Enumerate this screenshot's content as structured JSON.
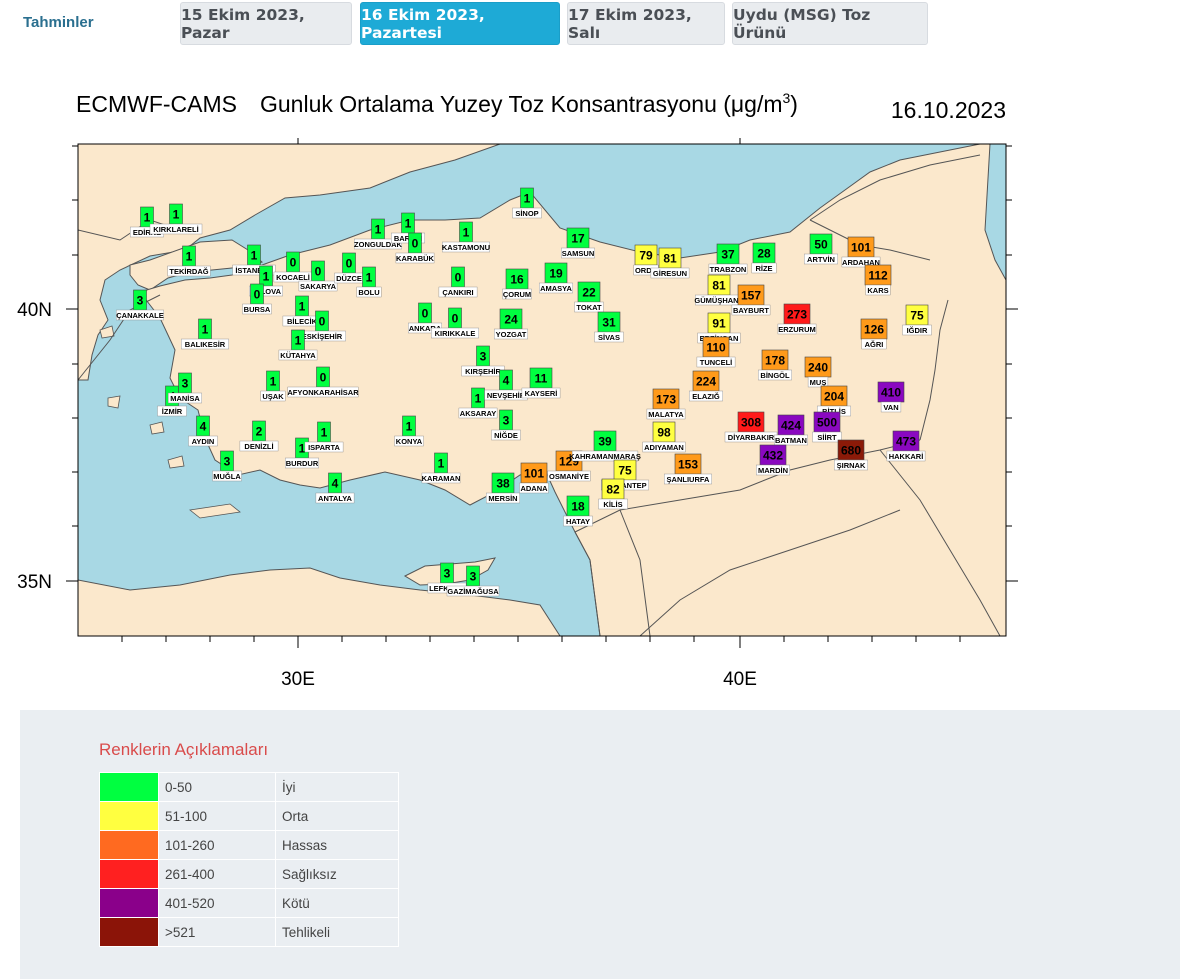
{
  "nav": {
    "label": "Tahminler",
    "tabs": [
      {
        "label": "15 Ekim 2023, Pazar",
        "active": false
      },
      {
        "label": "16 Ekim 2023, Pazartesi",
        "active": true
      },
      {
        "label": "17 Ekim 2023, Salı",
        "active": false
      },
      {
        "label": "Uydu (MSG) Toz Ürünü",
        "active": false
      }
    ]
  },
  "map": {
    "title_left": "ECMWF-CAMS",
    "title_main": "Gunluk Ortalama Yuzey Toz Konsantrasyonu (μg/m",
    "title_sup": "3",
    "title_close": ")",
    "date": "16.10.2023",
    "lat_labels": [
      "40N",
      "35N"
    ],
    "lon_labels": [
      "30E",
      "40E"
    ],
    "colors": {
      "sea": "#a8d8e4",
      "land": "#fbe8cc",
      "border": "#555555"
    },
    "stations": [
      {
        "name": "EDİRNE",
        "value": "1",
        "cls": 0
      },
      {
        "name": "KIRKLARELİ",
        "value": "1",
        "cls": 0
      },
      {
        "name": "TEKİRDAĞ",
        "value": "1",
        "cls": 0
      },
      {
        "name": "ÇANAKKALE",
        "value": "3",
        "cls": 0
      },
      {
        "name": "İSTANBUL",
        "value": "1",
        "cls": 0
      },
      {
        "name": "YALOVA",
        "value": "1",
        "cls": 0
      },
      {
        "name": "KOCAELİ",
        "value": "0",
        "cls": 0
      },
      {
        "name": "SAKARYA",
        "value": "0",
        "cls": 0
      },
      {
        "name": "DÜZCE",
        "value": "0",
        "cls": 0
      },
      {
        "name": "BOLU",
        "value": "1",
        "cls": 0
      },
      {
        "name": "ZONGULDAK",
        "value": "1",
        "cls": 0
      },
      {
        "name": "BARTIN",
        "value": "1",
        "cls": 0
      },
      {
        "name": "KARABÜK",
        "value": "0",
        "cls": 0
      },
      {
        "name": "KASTAMONU",
        "value": "1",
        "cls": 0
      },
      {
        "name": "SİNOP",
        "value": "1",
        "cls": 0
      },
      {
        "name": "BURSA",
        "value": "0",
        "cls": 0
      },
      {
        "name": "BİLECİK",
        "value": "1",
        "cls": 0
      },
      {
        "name": "ESKİŞEHİR",
        "value": "0",
        "cls": 0
      },
      {
        "name": "BALIKESİR",
        "value": "1",
        "cls": 0
      },
      {
        "name": "KÜTAHYA",
        "value": "1",
        "cls": 0
      },
      {
        "name": "ÇANKIRI",
        "value": "0",
        "cls": 0
      },
      {
        "name": "ANKARA",
        "value": "0",
        "cls": 0
      },
      {
        "name": "KIRIKKALE",
        "value": "0",
        "cls": 0
      },
      {
        "name": "ÇORUM",
        "value": "16",
        "cls": 0
      },
      {
        "name": "SAMSUN",
        "value": "17",
        "cls": 0
      },
      {
        "name": "AMASYA",
        "value": "19",
        "cls": 0
      },
      {
        "name": "TOKAT",
        "value": "22",
        "cls": 0
      },
      {
        "name": "YOZGAT",
        "value": "24",
        "cls": 0
      },
      {
        "name": "SİVAS",
        "value": "31",
        "cls": 0
      },
      {
        "name": "ORDU",
        "value": "79",
        "cls": 1
      },
      {
        "name": "GİRESUN",
        "value": "81",
        "cls": 1
      },
      {
        "name": "TRABZON",
        "value": "37",
        "cls": 0
      },
      {
        "name": "RİZE",
        "value": "28",
        "cls": 0
      },
      {
        "name": "ARTVİN",
        "value": "50",
        "cls": 0
      },
      {
        "name": "ARDAHAN",
        "value": "101",
        "cls": 2
      },
      {
        "name": "KARS",
        "value": "112",
        "cls": 2
      },
      {
        "name": "GÜMÜŞHANE",
        "value": "81",
        "cls": 1
      },
      {
        "name": "BAYBURT",
        "value": "157",
        "cls": 2
      },
      {
        "name": "ERZURUM",
        "value": "273",
        "cls": 3
      },
      {
        "name": "IĞDIR",
        "value": "75",
        "cls": 1
      },
      {
        "name": "AĞRI",
        "value": "126",
        "cls": 2
      },
      {
        "name": "ERZİNCAN",
        "value": "91",
        "cls": 1
      },
      {
        "name": "TUNCELİ",
        "value": "110",
        "cls": 2
      },
      {
        "name": "BİNGÖL",
        "value": "178",
        "cls": 2
      },
      {
        "name": "MUŞ",
        "value": "240",
        "cls": 2
      },
      {
        "name": "VAN",
        "value": "410",
        "cls": 4
      },
      {
        "name": "BİTLİS",
        "value": "204",
        "cls": 2
      },
      {
        "name": "İZMİR",
        "value": "4",
        "cls": 0
      },
      {
        "name": "MANİSA",
        "value": "3",
        "cls": 0
      },
      {
        "name": "UŞAK",
        "value": "1",
        "cls": 0
      },
      {
        "name": "AFYONKARAHİSAR",
        "value": "0",
        "cls": 0
      },
      {
        "name": "AYDIN",
        "value": "4",
        "cls": 0
      },
      {
        "name": "DENİZLİ",
        "value": "2",
        "cls": 0
      },
      {
        "name": "MUĞLA",
        "value": "3",
        "cls": 0
      },
      {
        "name": "BURDUR",
        "value": "1",
        "cls": 0
      },
      {
        "name": "ISPARTA",
        "value": "1",
        "cls": 0
      },
      {
        "name": "ANTALYA",
        "value": "4",
        "cls": 0
      },
      {
        "name": "KONYA",
        "value": "1",
        "cls": 0
      },
      {
        "name": "KARAMAN",
        "value": "1",
        "cls": 0
      },
      {
        "name": "AKSARAY",
        "value": "1",
        "cls": 0
      },
      {
        "name": "KIRŞEHİR",
        "value": "3",
        "cls": 0
      },
      {
        "name": "NEVŞEHİR",
        "value": "4",
        "cls": 0
      },
      {
        "name": "KAYSERİ",
        "value": "11",
        "cls": 0
      },
      {
        "name": "NİĞDE",
        "value": "3",
        "cls": 0
      },
      {
        "name": "MERSİN",
        "value": "38",
        "cls": 0
      },
      {
        "name": "ADANA",
        "value": "101",
        "cls": 2
      },
      {
        "name": "OSMANİYE",
        "value": "129",
        "cls": 2
      },
      {
        "name": "KAHRAMANMARAŞ",
        "value": "39",
        "cls": 0
      },
      {
        "name": "HATAY",
        "value": "18",
        "cls": 0
      },
      {
        "name": "GAZİANTEP",
        "value": "75",
        "cls": 1
      },
      {
        "name": "KİLİS",
        "value": "82",
        "cls": 1
      },
      {
        "name": "ADIYAMAN",
        "value": "98",
        "cls": 1
      },
      {
        "name": "MALATYA",
        "value": "173",
        "cls": 2
      },
      {
        "name": "ELAZIĞ",
        "value": "224",
        "cls": 2
      },
      {
        "name": "ŞANLIURFA",
        "value": "153",
        "cls": 2
      },
      {
        "name": "DİYARBAKIR",
        "value": "308",
        "cls": 3
      },
      {
        "name": "BATMAN",
        "value": "424",
        "cls": 4
      },
      {
        "name": "SİİRT",
        "value": "500",
        "cls": 4
      },
      {
        "name": "MARDİN",
        "value": "432",
        "cls": 4
      },
      {
        "name": "ŞIRNAK",
        "value": "680",
        "cls": 5
      },
      {
        "name": "HAKKARİ",
        "value": "473",
        "cls": 4
      },
      {
        "name": "LEFKOŞA",
        "value": "3",
        "cls": 0
      },
      {
        "name": "GAZİMAĞUSA",
        "value": "3",
        "cls": 0
      }
    ]
  },
  "legend": {
    "title": "Renklerin Açıklamaları",
    "rows": [
      {
        "range": "0-50",
        "label": "İyi",
        "color": "#00ff40"
      },
      {
        "range": "51-100",
        "label": "Orta",
        "color": "#ffff40"
      },
      {
        "range": "101-260",
        "label": "Hassas",
        "color": "#ff6a20"
      },
      {
        "range": "261-400",
        "label": "Sağlıksız",
        "color": "#ff2020"
      },
      {
        "range": "401-520",
        "label": "Kötü",
        "color": "#8a008a"
      },
      {
        "range": ">521",
        "label": "Tehlikeli",
        "color": "#8b1408"
      }
    ]
  }
}
